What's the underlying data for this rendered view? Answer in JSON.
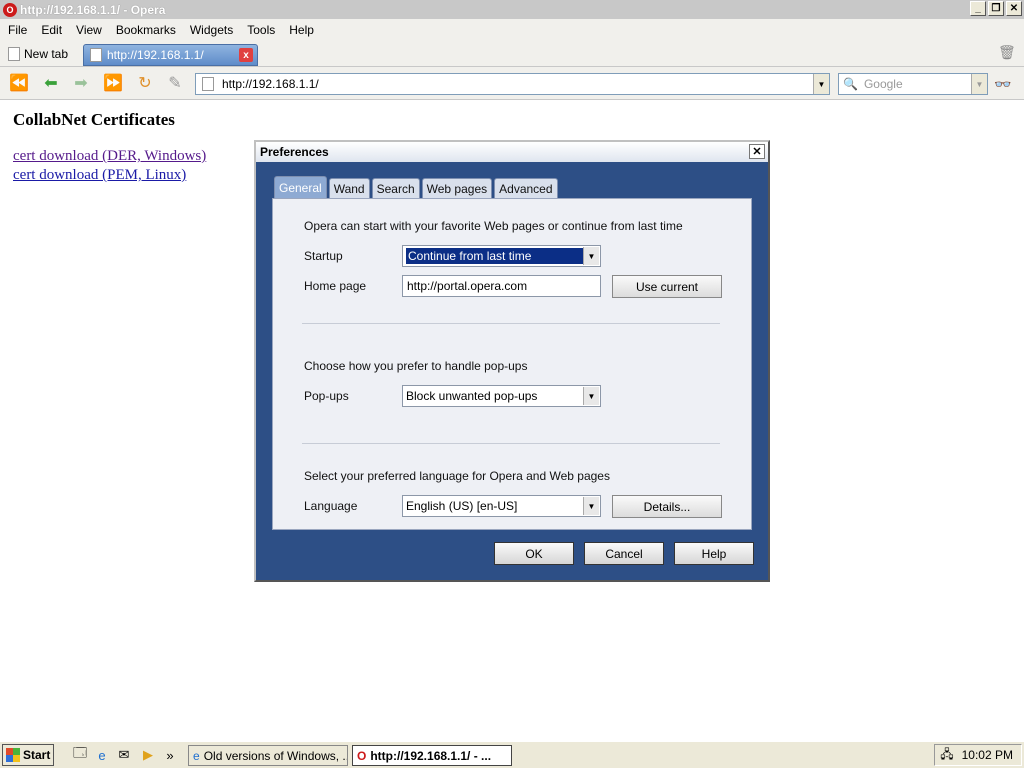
{
  "window": {
    "title": "http://192.168.1.1/ - Opera"
  },
  "menu": [
    "File",
    "Edit",
    "View",
    "Bookmarks",
    "Widgets",
    "Tools",
    "Help"
  ],
  "tabs": {
    "new_tab": "New tab",
    "active_tab": "http://192.168.1.1/"
  },
  "address": {
    "url": "http://192.168.1.1/"
  },
  "search": {
    "placeholder": "Google"
  },
  "page": {
    "heading": "CollabNet Certificates",
    "links": [
      "cert download (DER, Windows)",
      "cert download (PEM, Linux)"
    ]
  },
  "dialog": {
    "title": "Preferences",
    "tabs": [
      "General",
      "Wand",
      "Search",
      "Web pages",
      "Advanced"
    ],
    "active_tab": "General",
    "startup_intro": "Opera can start with your favorite Web pages or continue from last time",
    "startup_label": "Startup",
    "startup_value": "Continue from last time",
    "home_label": "Home page",
    "home_value": "http://portal.opera.com",
    "use_current": "Use current",
    "popups_intro": "Choose how you prefer to handle pop-ups",
    "popups_label": "Pop-ups",
    "popups_value": "Block unwanted pop-ups",
    "language_intro": "Select your preferred language for Opera and Web pages",
    "language_label": "Language",
    "language_value": "English (US) [en-US]",
    "details": "Details...",
    "ok": "OK",
    "cancel": "Cancel",
    "help": "Help"
  },
  "taskbar": {
    "start": "Start",
    "tasks": [
      "Old versions of Windows, ...",
      "http://192.168.1.1/ - ..."
    ],
    "clock": "10:02 PM"
  }
}
